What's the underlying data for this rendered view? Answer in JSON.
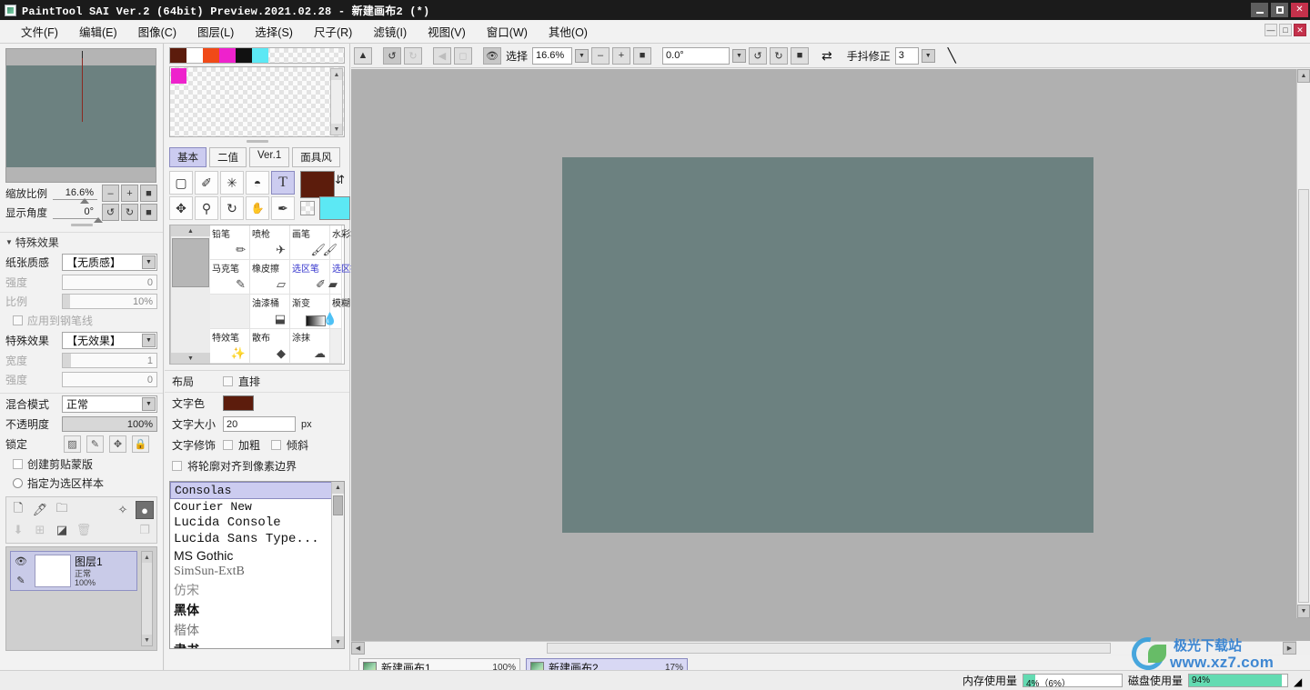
{
  "window": {
    "title": "PaintTool SAI Ver.2 (64bit) Preview.2021.02.28 - 新建画布2 (*)",
    "minimize_label": "—",
    "maximize_label": "□",
    "close_label": "✕"
  },
  "menubar": {
    "items": [
      {
        "label": "文件(F)"
      },
      {
        "label": "编辑(E)"
      },
      {
        "label": "图像(C)"
      },
      {
        "label": "图层(L)"
      },
      {
        "label": "选择(S)"
      },
      {
        "label": "尺子(R)"
      },
      {
        "label": "滤镜(I)"
      },
      {
        "label": "视图(V)"
      },
      {
        "label": "窗口(W)"
      },
      {
        "label": "其他(O)"
      }
    ],
    "doc_minimize": "—",
    "doc_restore": "□",
    "doc_close": "✕"
  },
  "navigator": {
    "zoom_label": "缩放比例",
    "zoom_value": "16.6%",
    "angle_label": "显示角度",
    "angle_value": "0°",
    "zoom_out": "–",
    "zoom_in": "+",
    "zoom_reset": "■",
    "rotate_ccw": "↺",
    "rotate_cw": "↻",
    "rotate_reset": "■",
    "canvas_color": "#6c8180",
    "guide_color": "#8b2a22"
  },
  "effects": {
    "section_title": "特殊效果",
    "paper_label": "纸张质感",
    "paper_value": "【无质感】",
    "strength_label": "强度",
    "strength_value": "0",
    "scale_label": "比例",
    "scale_value": "10%",
    "apply_pen_label": "应用到钢笔线",
    "effect_label": "特殊效果",
    "effect_value": "【无效果】",
    "width_label": "宽度",
    "width_value": "1",
    "effect_strength_label": "强度",
    "effect_strength_value": "0"
  },
  "layer_props": {
    "blend_label": "混合模式",
    "blend_value": "正常",
    "opacity_label": "不透明度",
    "opacity_value": "100%",
    "lock_label": "锁定",
    "lock_buttons": [
      "lock-alpha-icon",
      "lock-paint-icon",
      "lock-move-icon",
      "lock-all-icon"
    ],
    "clipping_label": "创建剪贴蒙版",
    "selection_source_label": "指定为选区样本"
  },
  "layer_toolbar": {
    "row1": [
      "new-layer-icon",
      "new-linework-layer-icon",
      "new-folder-icon",
      "layer-transform-icon",
      "mask-icon"
    ],
    "row2": [
      "merge-down-icon",
      "add-to-group-icon",
      "clear-layer-icon",
      "delete-layer-icon",
      "duplicate-layer-icon"
    ]
  },
  "layers": [
    {
      "name": "图层1",
      "mode": "正常",
      "opacity": "100%",
      "visible": true,
      "selected": true
    }
  ],
  "palette": {
    "strip_colors": [
      "#5c1c0c",
      "#ffffff",
      "#f04a18",
      "#ee22cc",
      "#111111",
      "#5ce8f4"
    ],
    "panel_first_color": "#ee22cc",
    "dropdown_icon": "chevron-down-icon"
  },
  "tool_tabs": [
    {
      "label": "基本",
      "active": true
    },
    {
      "label": "二值",
      "active": false
    },
    {
      "label": "Ver.1",
      "active": false
    },
    {
      "label": "面具风",
      "active": false
    }
  ],
  "tools": {
    "row1": [
      {
        "name": "rect-select-tool",
        "glyph": "▢",
        "active": false
      },
      {
        "name": "lasso-select-tool",
        "glyph": "✐",
        "active": false
      },
      {
        "name": "magic-wand-tool",
        "glyph": "✳",
        "active": false
      },
      {
        "name": "select-move-tool",
        "glyph": "◓",
        "active": false
      },
      {
        "name": "text-tool",
        "glyph": "T",
        "active": true
      }
    ],
    "row2": [
      {
        "name": "move-tool",
        "glyph": "✥",
        "active": false
      },
      {
        "name": "zoom-tool",
        "glyph": "⚲",
        "active": false
      },
      {
        "name": "rotate-tool",
        "glyph": "↻",
        "active": false
      },
      {
        "name": "hand-tool",
        "glyph": "✋",
        "active": false
      },
      {
        "name": "eyedropper-tool",
        "glyph": "✒",
        "active": false
      }
    ],
    "main_color": "#5c1c0c",
    "sub_color": "#5ce8f4",
    "swap_icon": "swap-colors-icon",
    "alpha_icon": "transparency-icon"
  },
  "brushes": [
    {
      "label": "铅笔",
      "icon": "pencil-icon"
    },
    {
      "label": "喷枪",
      "icon": "airbrush-icon"
    },
    {
      "label": "画笔",
      "icon": "brush-icon"
    },
    {
      "label": "水彩笔",
      "icon": "watercolor-icon"
    },
    {
      "label": "马克笔",
      "icon": "marker-icon"
    },
    {
      "label": "橡皮擦",
      "icon": "eraser-icon"
    },
    {
      "label": "选区笔",
      "icon": "select-pen-icon",
      "blue": true
    },
    {
      "label": "选区擦",
      "icon": "select-eraser-icon",
      "blue": true
    },
    {
      "label": "",
      "icon": "",
      "empty": true
    },
    {
      "label": "油漆桶",
      "icon": "bucket-icon"
    },
    {
      "label": "渐变",
      "icon": "gradient-icon"
    },
    {
      "label": "模糊",
      "icon": "blur-icon"
    },
    {
      "label": "特效笔",
      "icon": "effect-pen-icon"
    },
    {
      "label": "散布",
      "icon": "scatter-icon"
    },
    {
      "label": "涂抹",
      "icon": "smudge-icon"
    },
    {
      "label": "",
      "icon": "",
      "empty": true
    }
  ],
  "text_options": {
    "layout_label": "布局",
    "vertical_label": "直排",
    "color_label": "文字色",
    "color_value": "#5c1c0c",
    "size_label": "文字大小",
    "size_value": "20",
    "size_unit": "px",
    "decor_label": "文字修饰",
    "bold_label": "加粗",
    "italic_label": "倾斜",
    "pixel_align_label": "将轮廓对齐到像素边界"
  },
  "fonts": [
    {
      "name": "Consolas",
      "style": "mono",
      "selected": true
    },
    {
      "name": "Courier New",
      "style": "mono",
      "selected": false
    },
    {
      "name": "Lucida Console",
      "style": "mono",
      "selected": false
    },
    {
      "name": "Lucida Sans Type...",
      "style": "mono",
      "selected": false
    },
    {
      "name": "MS Gothic",
      "style": "sans",
      "selected": false
    },
    {
      "name": "SimSun-ExtB",
      "style": "serif",
      "selected": false
    },
    {
      "name": "仿宋",
      "style": "serif",
      "selected": false
    },
    {
      "name": "黑体",
      "style": "sans",
      "selected": false
    },
    {
      "name": "楷体",
      "style": "serif",
      "selected": false
    },
    {
      "name": "隶书",
      "style": "serif",
      "selected": false
    }
  ],
  "canvasbar": {
    "undo_icon": "undo-icon",
    "redo_icon": "redo-icon",
    "prev_icon": "prev-icon",
    "next_icon": "next-icon",
    "eye_icon": "visibility-icon",
    "select_label": "选择",
    "zoom_value": "16.6%",
    "zoom_out": "–",
    "zoom_in": "+",
    "zoom_reset": "■",
    "angle_value": "0.0°",
    "rotate_ccw": "↺",
    "rotate_cw": "↻",
    "rotate_reset": "■",
    "flip_icon": "flip-horizontal-icon",
    "stabilizer_label": "手抖修正",
    "stabilizer_value": "3",
    "line_icon": "line-tool-icon"
  },
  "canvas": {
    "background": "#b0b0b0",
    "artboard_color": "#6c8180"
  },
  "doc_tabs": [
    {
      "name": "新建画布1",
      "zoom": "100%",
      "active": false
    },
    {
      "name": "新建画布2",
      "zoom": "17%",
      "active": true
    }
  ],
  "status": {
    "memory_label": "内存使用量",
    "memory_value": "4%（6%）",
    "memory_percent": 12,
    "disk_label": "磁盘使用量",
    "disk_value": "94%",
    "disk_percent": 94,
    "accent_color": "#63dbb2"
  },
  "watermark": {
    "top_text": "极光下载站",
    "url": "www.xz7.com"
  }
}
